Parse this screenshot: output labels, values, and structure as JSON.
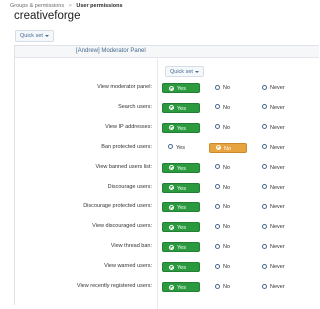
{
  "breadcrumb": {
    "items": [
      "Groups & permissions",
      "User permissions"
    ],
    "separator": ">"
  },
  "page_title": "creativeforge",
  "quick_set_label": "Quick set",
  "panel": {
    "title": "[Andrew] Moderator Panel",
    "quick_set_label": "Quick set"
  },
  "options": {
    "yes": "Yes",
    "no": "No",
    "never": "Never"
  },
  "colors": {
    "yes_selected": "#2b9a3f",
    "no_selected": "#e7a33e",
    "link": "#47698f"
  },
  "permissions": [
    {
      "label": "View moderator panel:",
      "value": "yes"
    },
    {
      "label": "Search users:",
      "value": "yes"
    },
    {
      "label": "View IP addresses:",
      "value": "yes"
    },
    {
      "label": "Ban protected users:",
      "value": "no"
    },
    {
      "label": "View banned users list:",
      "value": "yes"
    },
    {
      "label": "Discourage users:",
      "value": "yes"
    },
    {
      "label": "Discourage protected users:",
      "value": "yes"
    },
    {
      "label": "View discouraged users:",
      "value": "yes"
    },
    {
      "label": "View thread ban:",
      "value": "yes"
    },
    {
      "label": "View warned users:",
      "value": "yes"
    },
    {
      "label": "View recently registered users:",
      "value": "yes"
    }
  ]
}
